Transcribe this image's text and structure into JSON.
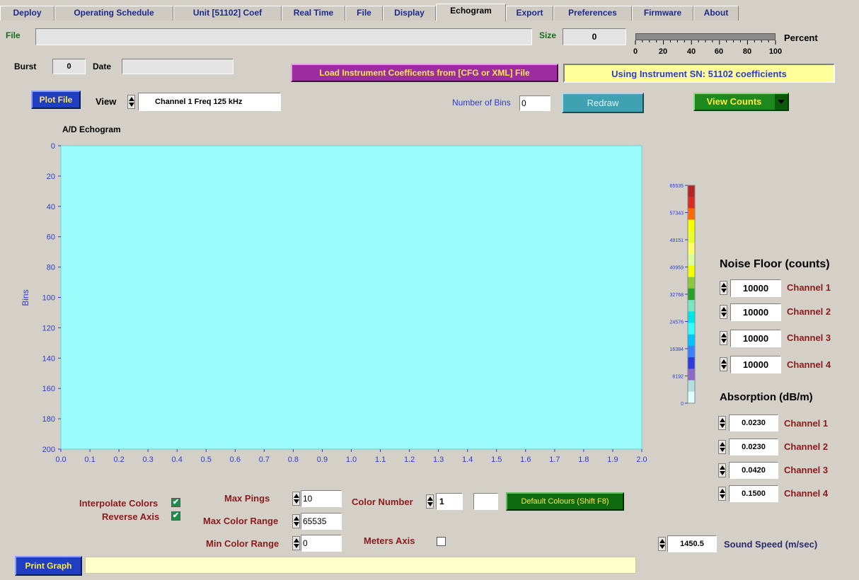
{
  "tabs": [
    "Deploy",
    "Operating Schedule",
    "Unit [51102] Coef",
    "Real Time",
    "File",
    "Display",
    "Echogram",
    "Export",
    "Preferences",
    "Firmware",
    "About"
  ],
  "active_tab": "Echogram",
  "file": {
    "label": "File",
    "value": ""
  },
  "size": {
    "label": "Size",
    "value": "0"
  },
  "progress": {
    "label": "Percent",
    "value": 0,
    "ticks": [
      "0",
      "20",
      "40",
      "60",
      "80",
      "100"
    ]
  },
  "burst": {
    "label": "Burst",
    "value": "0"
  },
  "date": {
    "label": "Date",
    "value": ""
  },
  "load_button": "Load Instrument Coefficents  from [CFG or XML]  File",
  "instrument_status": "Using Instrument SN: 51102 coefficients",
  "plot_file_button": "Plot File",
  "view": {
    "label": "View",
    "value": "Channel 1 Freq 125 kHz"
  },
  "bins": {
    "label": "Number of Bins",
    "value": "0"
  },
  "redraw_button": "Redraw",
  "view_counts_button": "View Counts",
  "chart": {
    "title": "A/D Echogram",
    "ylabel": "Bins",
    "y_ticks": [
      "0",
      "20",
      "40",
      "60",
      "80",
      "100",
      "120",
      "140",
      "160",
      "180",
      "200"
    ],
    "x_ticks": [
      "0.0",
      "0.1",
      "0.2",
      "0.3",
      "0.4",
      "0.5",
      "0.6",
      "0.7",
      "0.8",
      "0.9",
      "1.0",
      "1.1",
      "1.2",
      "1.3",
      "1.4",
      "1.5",
      "1.6",
      "1.7",
      "1.8",
      "1.9",
      "2.0"
    ],
    "fill_color": "#9cfbfb"
  },
  "colorbar": {
    "ticks": [
      "65535",
      "57343",
      "49151",
      "40959",
      "32768",
      "24576",
      "16384",
      "8192",
      "0"
    ],
    "colors": [
      "#b52323",
      "#d92d22",
      "#ff6b00",
      "#f4ff00",
      "#e9ff2d",
      "#ffff66",
      "#d8ff9c",
      "#f6ff00",
      "#8ac83c",
      "#2a9f2a",
      "#78e4c0",
      "#00e5e5",
      "#33ffff",
      "#00c4ff",
      "#3b82ff",
      "#2c3ae0",
      "#8d69c9",
      "#b2dede",
      "#e0ffff"
    ]
  },
  "noise_floor": {
    "title": "Noise Floor (counts)",
    "rows": [
      {
        "value": "10000",
        "label": "Channel 1"
      },
      {
        "value": "10000",
        "label": "Channel 2"
      },
      {
        "value": "10000",
        "label": "Channel 3"
      },
      {
        "value": "10000",
        "label": "Channel 4"
      }
    ]
  },
  "absorption": {
    "title": "Absorption (dB/m)",
    "rows": [
      {
        "value": "0.0230",
        "label": "Channel 1"
      },
      {
        "value": "0.0230",
        "label": "Channel 2"
      },
      {
        "value": "0.0420",
        "label": "Channel 3"
      },
      {
        "value": "0.1500",
        "label": "Channel 4"
      }
    ]
  },
  "interpolate_colors": {
    "label": "Interpolate Colors",
    "checked": true
  },
  "reverse_axis": {
    "label": "Reverse Axis",
    "checked": true
  },
  "max_pings": {
    "label": "Max Pings",
    "value": "10"
  },
  "max_color_range": {
    "label": "Max Color Range",
    "value": "65535"
  },
  "min_color_range": {
    "label": "Min Color Range",
    "value": "0"
  },
  "color_number": {
    "label": "Color Number",
    "value": "1"
  },
  "default_colours_button": "Default Colours (Shift F8)",
  "meters_axis": {
    "label": "Meters Axis",
    "checked": false
  },
  "sound_speed": {
    "label": "Sound Speed (m/sec)",
    "value": "1450.5"
  },
  "print_graph_button": "Print Graph",
  "status_bar": ""
}
